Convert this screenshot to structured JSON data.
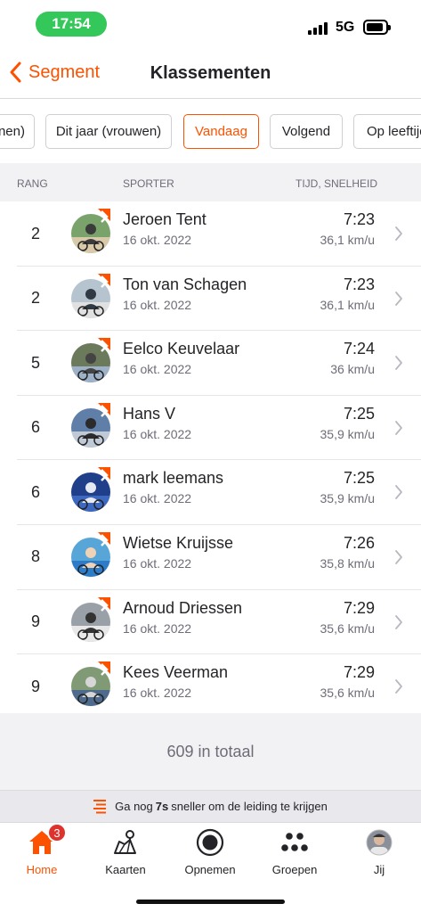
{
  "status": {
    "time": "17:54",
    "network": "5G"
  },
  "nav": {
    "back_label": "Segment",
    "title": "Klassementen"
  },
  "filters": [
    "nen)",
    "Dit jaar (vrouwen)",
    "Vandaag",
    "Volgend",
    "Op leeftijd"
  ],
  "active_filter": "Vandaag",
  "table_header": {
    "rank": "RANG",
    "athlete": "SPORTER",
    "time_speed": "TIJD, SNELHEID"
  },
  "rows": [
    {
      "rank": "2",
      "name": "Jeroen Tent",
      "date": "16 okt. 2022",
      "time": "7:23",
      "speed": "36,1 km/u"
    },
    {
      "rank": "2",
      "name": "Ton van Schagen",
      "date": "16 okt. 2022",
      "time": "7:23",
      "speed": "36,1 km/u"
    },
    {
      "rank": "5",
      "name": "Eelco Keuvelaar",
      "date": "16 okt. 2022",
      "time": "7:24",
      "speed": "36 km/u"
    },
    {
      "rank": "6",
      "name": "Hans V",
      "date": "16 okt. 2022",
      "time": "7:25",
      "speed": "35,9 km/u"
    },
    {
      "rank": "6",
      "name": "mark leemans",
      "date": "16 okt. 2022",
      "time": "7:25",
      "speed": "35,9 km/u"
    },
    {
      "rank": "8",
      "name": "Wietse Kruijsse",
      "date": "16 okt. 2022",
      "time": "7:26",
      "speed": "35,8 km/u"
    },
    {
      "rank": "9",
      "name": "Arnoud Driessen",
      "date": "16 okt. 2022",
      "time": "7:29",
      "speed": "35,6 km/u"
    },
    {
      "rank": "9",
      "name": "Kees Veerman",
      "date": "16 okt. 2022",
      "time": "7:29",
      "speed": "35,6 km/u"
    }
  ],
  "total": "609 in totaal",
  "hint": {
    "prefix": "Ga nog",
    "seconds": "7s",
    "suffix": "sneller om de leiding te krijgen"
  },
  "tabs": [
    {
      "label": "Home",
      "icon": "home-icon",
      "badge": "3"
    },
    {
      "label": "Kaarten",
      "icon": "map-icon"
    },
    {
      "label": "Opnemen",
      "icon": "record-icon"
    },
    {
      "label": "Groepen",
      "icon": "groups-icon"
    },
    {
      "label": "Jij",
      "icon": "profile-avatar"
    }
  ],
  "colors": {
    "accent": "#fc5200",
    "badge": "#e0322c",
    "status_pill": "#34c759"
  }
}
